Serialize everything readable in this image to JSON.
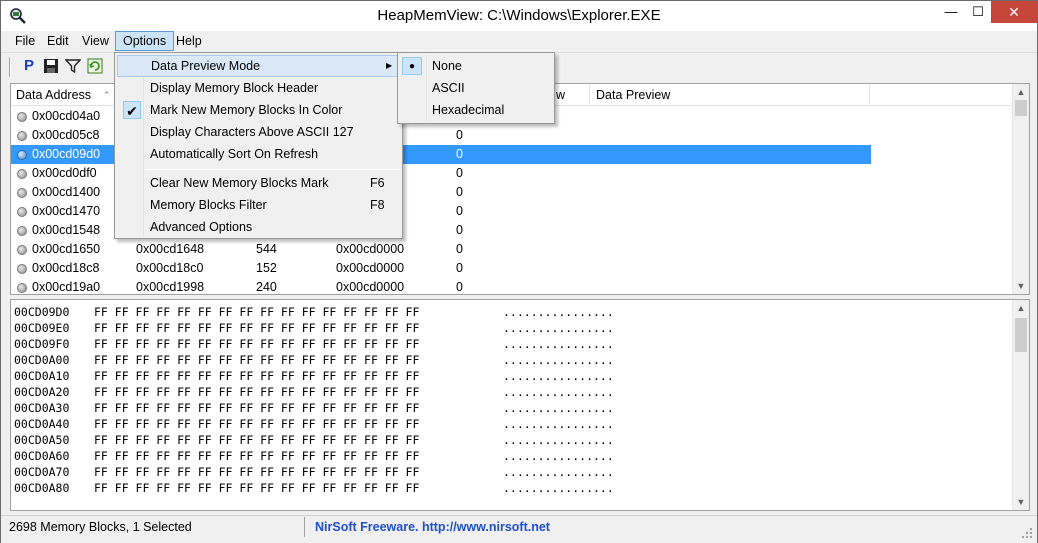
{
  "window": {
    "title": "HeapMemView:   C:\\Windows\\Explorer.EXE",
    "minimize": "—",
    "maximize": "☐",
    "close": "✕"
  },
  "menubar": {
    "items": [
      "File",
      "Edit",
      "View",
      "Options",
      "Help"
    ],
    "active": "Options"
  },
  "toolbar": {
    "icons": [
      "properties-icon",
      "save-icon",
      "filter-icon",
      "refresh-icon"
    ]
  },
  "list": {
    "columns": [
      "Data Address",
      "w",
      "Data Preview"
    ],
    "sort_indicator": "⌃",
    "rows": [
      {
        "address": "0x00cd04a0",
        "block": "",
        "size": "",
        "heap": "",
        "flag": ""
      },
      {
        "address": "0x00cd05c8",
        "block": "",
        "size": "",
        "heap": "",
        "flag": "0"
      },
      {
        "address": "0x00cd09d0",
        "block": "",
        "size": "",
        "heap": "",
        "flag": "0",
        "selected": true
      },
      {
        "address": "0x00cd0df0",
        "block": "",
        "size": "",
        "heap": "",
        "flag": "0"
      },
      {
        "address": "0x00cd1400",
        "block": "",
        "size": "",
        "heap": "",
        "flag": "0"
      },
      {
        "address": "0x00cd1470",
        "block": "",
        "size": "",
        "heap": "",
        "flag": "0"
      },
      {
        "address": "0x00cd1548",
        "block": "",
        "size": "",
        "heap": "",
        "flag": "0"
      },
      {
        "address": "0x00cd1650",
        "block": "0x00cd1648",
        "size": "544",
        "heap": "0x00cd0000",
        "flag": "0"
      },
      {
        "address": "0x00cd18c8",
        "block": "0x00cd18c0",
        "size": "152",
        "heap": "0x00cd0000",
        "flag": "0"
      },
      {
        "address": "0x00cd19a0",
        "block": "0x00cd1998",
        "size": "240",
        "heap": "0x00cd0000",
        "flag": "0"
      }
    ]
  },
  "hex": {
    "lines": [
      {
        "addr": "00CD09D0",
        "bytes": "FF FF FF FF FF FF FF FF FF FF FF FF FF FF FF FF",
        "ascii": "................"
      },
      {
        "addr": "00CD09E0",
        "bytes": "FF FF FF FF FF FF FF FF FF FF FF FF FF FF FF FF",
        "ascii": "................"
      },
      {
        "addr": "00CD09F0",
        "bytes": "FF FF FF FF FF FF FF FF FF FF FF FF FF FF FF FF",
        "ascii": "................"
      },
      {
        "addr": "00CD0A00",
        "bytes": "FF FF FF FF FF FF FF FF FF FF FF FF FF FF FF FF",
        "ascii": "................"
      },
      {
        "addr": "00CD0A10",
        "bytes": "FF FF FF FF FF FF FF FF FF FF FF FF FF FF FF FF",
        "ascii": "................"
      },
      {
        "addr": "00CD0A20",
        "bytes": "FF FF FF FF FF FF FF FF FF FF FF FF FF FF FF FF",
        "ascii": "................"
      },
      {
        "addr": "00CD0A30",
        "bytes": "FF FF FF FF FF FF FF FF FF FF FF FF FF FF FF FF",
        "ascii": "................"
      },
      {
        "addr": "00CD0A40",
        "bytes": "FF FF FF FF FF FF FF FF FF FF FF FF FF FF FF FF",
        "ascii": "................"
      },
      {
        "addr": "00CD0A50",
        "bytes": "FF FF FF FF FF FF FF FF FF FF FF FF FF FF FF FF",
        "ascii": "................"
      },
      {
        "addr": "00CD0A60",
        "bytes": "FF FF FF FF FF FF FF FF FF FF FF FF FF FF FF FF",
        "ascii": "................"
      },
      {
        "addr": "00CD0A70",
        "bytes": "FF FF FF FF FF FF FF FF FF FF FF FF FF FF FF FF",
        "ascii": "................"
      },
      {
        "addr": "00CD0A80",
        "bytes": "FF FF FF FF FF FF FF FF FF FF FF FF FF FF FF FF",
        "ascii": "................"
      }
    ]
  },
  "options_menu": {
    "items": [
      {
        "label": "Data Preview Mode",
        "shortcut": "",
        "submenu": true,
        "checked": false,
        "highlighted": true
      },
      {
        "label": "Display Memory Block Header",
        "shortcut": "",
        "checked": false
      },
      {
        "label": "Mark New Memory Blocks In Color",
        "shortcut": "",
        "checked": true
      },
      {
        "label": "Display Characters Above ASCII 127",
        "shortcut": "",
        "checked": false
      },
      {
        "label": "Automatically Sort On Refresh",
        "shortcut": "",
        "checked": false
      },
      {
        "label": "Clear New Memory Blocks Mark",
        "shortcut": "F6",
        "checked": false
      },
      {
        "label": "Memory Blocks Filter",
        "shortcut": "F8",
        "checked": false
      },
      {
        "label": "Advanced Options",
        "shortcut": "",
        "checked": false
      }
    ],
    "submenu_arrow": "▶",
    "check_glyph": "✔"
  },
  "preview_submenu": {
    "items": [
      {
        "label": "None",
        "selected": true
      },
      {
        "label": "ASCII",
        "selected": false
      },
      {
        "label": "Hexadecimal",
        "selected": false
      }
    ],
    "radio_glyph": "●"
  },
  "statusbar": {
    "left": "2698 Memory Blocks, 1 Selected",
    "right": "NirSoft Freeware.  http://www.nirsoft.net"
  },
  "colors": {
    "selection": "#3399ff",
    "menu_highlight": "#cce4f7",
    "link": "#1e4fcc",
    "close_button": "#c7463c"
  }
}
